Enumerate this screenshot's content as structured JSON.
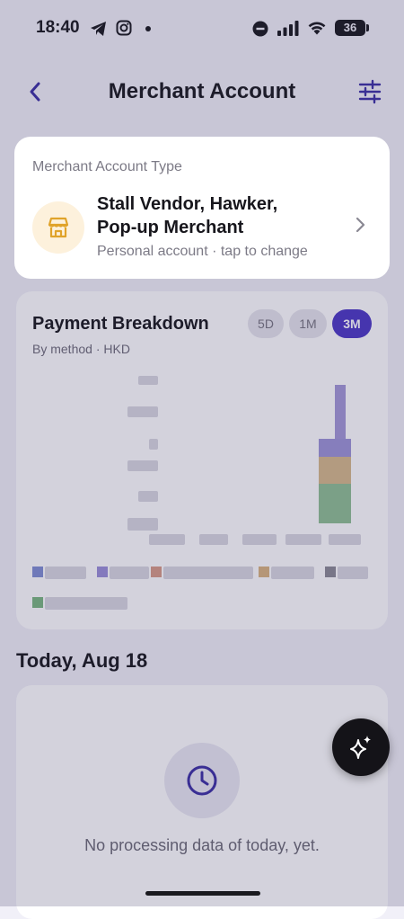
{
  "status_bar": {
    "time": "18:40",
    "battery": "36",
    "icons": [
      "telegram-icon",
      "instagram-icon",
      "notification-dot-icon",
      "do-not-disturb-icon",
      "cellular-signal-icon",
      "wifi-icon",
      "battery-icon"
    ]
  },
  "header": {
    "title": "Merchant Account",
    "back_icon": "chevron-left-icon",
    "filter_icon": "sliders-icon"
  },
  "account_type": {
    "label": "Merchant Account Type",
    "name_line1": "Stall Vendor, Hawker,",
    "name_line2": "Pop-up Merchant",
    "subtitle": "Personal account · tap to change",
    "icon": "store-icon",
    "chevron_icon": "chevron-right-icon"
  },
  "payment_breakdown": {
    "title": "Payment Breakdown",
    "subtitle": "By method · HKD",
    "ranges": [
      "5D",
      "1M",
      "3M"
    ],
    "selected_range": "3M"
  },
  "today": {
    "heading": "Today, Aug 18",
    "empty_message": "No processing data of today, yet.",
    "icon": "clock-icon"
  },
  "fab": {
    "icon": "sparkles-icon"
  },
  "colors": {
    "accent": "#4b37c4",
    "store_icon": "#e0a32a",
    "background": "#f1f0f8"
  }
}
